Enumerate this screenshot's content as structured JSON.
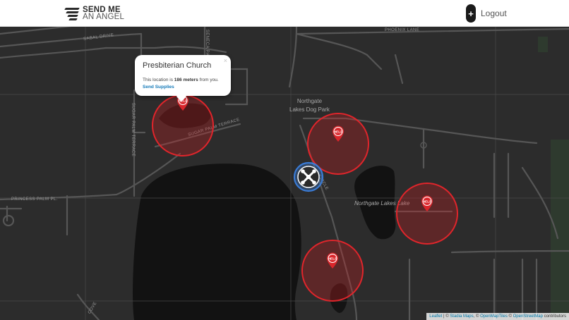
{
  "header": {
    "logo_line1": "SEND ME",
    "logo_line2": "AN ANGEL",
    "logout_icon": "+",
    "logout_label": "Logout"
  },
  "map": {
    "street_labels": {
      "sabal": "SABAL DRIVE",
      "phoenix": "PHOENIX LANE",
      "sugar_palm": "SUGAR PALM TERRACE",
      "sugar_palm_vertical": "SUGAR PALM TERRACE",
      "princess_palm": "PRINCESS PALM PL.",
      "cove": "COVE",
      "upper_vertical": "SENECA PALM",
      "circle": "CIRCLE"
    },
    "poi_labels": {
      "dog_park_line1": "Northgate",
      "dog_park_line2": "Lakes Dog Park",
      "lake": "Northgate Lakes Lake"
    },
    "help_marker_label": "HELP",
    "colors": {
      "background": "#2c2c2c",
      "roads": "#565656",
      "water": "#121212",
      "help_red": "#e0252b",
      "drone_blue": "#3a7bd5"
    },
    "icons": {
      "help_marker": "help-pin-icon",
      "drone": "drone-icon",
      "close": "close-icon"
    }
  },
  "popup": {
    "title": "Presbiterian Church",
    "text_before": "This location is ",
    "distance": "186 meters",
    "text_after": " from you.",
    "link": "Send Supplies",
    "close": "×"
  },
  "attribution": {
    "leaflet": "Leaflet",
    "separator": " | © ",
    "stadia": "Stadia Maps",
    "sep2": ", © ",
    "openmaptiles": "OpenMapTiles",
    "sep3": " © ",
    "osm": "OpenStreetMap",
    "suffix": " contributors"
  }
}
